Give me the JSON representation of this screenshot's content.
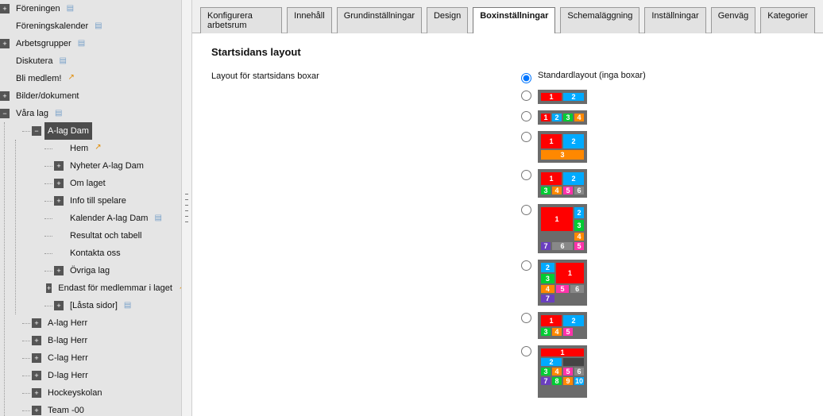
{
  "sidebar": {
    "items": [
      {
        "label": "Föreningen",
        "toggle": "plus",
        "doc": true
      },
      {
        "label": "Föreningskalender",
        "toggle": "spacer",
        "doc": true
      },
      {
        "label": "Arbetsgrupper",
        "toggle": "plus",
        "doc": true
      },
      {
        "label": "Diskutera",
        "toggle": "spacer",
        "doc": true
      },
      {
        "label": "Bli medlem!",
        "toggle": "spacer",
        "link": true
      },
      {
        "label": "Bilder/dokument",
        "toggle": "plus"
      },
      {
        "label": "Våra lag",
        "toggle": "minus",
        "doc": true,
        "children": [
          {
            "label": "A-lag Dam",
            "toggle": "minus",
            "selected": true,
            "children": [
              {
                "label": "Hem",
                "toggle": "spacer",
                "link": true
              },
              {
                "label": "Nyheter A-lag Dam",
                "toggle": "plus"
              },
              {
                "label": "Om laget",
                "toggle": "plus"
              },
              {
                "label": "Info till spelare",
                "toggle": "plus"
              },
              {
                "label": "Kalender A-lag Dam",
                "toggle": "spacer",
                "doc": true
              },
              {
                "label": "Resultat och tabell",
                "toggle": "spacer"
              },
              {
                "label": "Kontakta oss",
                "toggle": "spacer"
              },
              {
                "label": "Övriga lag",
                "toggle": "plus"
              },
              {
                "label": "Endast för medlemmar i laget",
                "toggle": "plus",
                "link": true
              },
              {
                "label": "[Låsta sidor]",
                "toggle": "plus",
                "doc": true
              }
            ]
          },
          {
            "label": "A-lag Herr",
            "toggle": "plus"
          },
          {
            "label": "B-lag Herr",
            "toggle": "plus"
          },
          {
            "label": "C-lag Herr",
            "toggle": "plus"
          },
          {
            "label": "D-lag Herr",
            "toggle": "plus"
          },
          {
            "label": "Hockeyskolan",
            "toggle": "plus"
          },
          {
            "label": "Team -00",
            "toggle": "plus"
          }
        ]
      }
    ]
  },
  "tabs": [
    {
      "label": "Konfigurera arbetsrum"
    },
    {
      "label": "Innehåll"
    },
    {
      "label": "Grundinställningar"
    },
    {
      "label": "Design"
    },
    {
      "label": "Boxinställningar",
      "active": true
    },
    {
      "label": "Schemaläggning"
    },
    {
      "label": "Inställningar"
    },
    {
      "label": "Genväg"
    },
    {
      "label": "Kategorier"
    }
  ],
  "panel": {
    "section_title": "Startsidans layout",
    "form_label": "Layout för startsidans boxar",
    "default_label": "Standardlayout (inga boxar)"
  },
  "layout_options": [
    {
      "id": "default",
      "selected": true,
      "text_only": true
    },
    {
      "id": "l2",
      "grid": "t-2",
      "cells": [
        [
          "1",
          "c-red"
        ],
        [
          "2",
          "c-blue"
        ]
      ]
    },
    {
      "id": "l4",
      "grid": "t-4",
      "cells": [
        [
          "1",
          "c-red"
        ],
        [
          "2",
          "c-blue"
        ],
        [
          "3",
          "c-green"
        ],
        [
          "4",
          "c-orange"
        ]
      ]
    },
    {
      "id": "l2row",
      "grid": "t-2x2a",
      "cells": [
        [
          "1",
          "c-red"
        ],
        [
          "2",
          "c-blue"
        ],
        [
          "3",
          "c-orange"
        ]
      ]
    },
    {
      "id": "l2x3",
      "grid": "t-2x2b",
      "cells": [
        [
          "1",
          "c-red"
        ],
        [
          "2",
          "c-blue"
        ],
        [
          "3",
          "c-green"
        ],
        [
          "4",
          "c-orange"
        ],
        [
          "5",
          "c-pink"
        ],
        [
          "6",
          "c-grey"
        ]
      ]
    },
    {
      "id": "l7",
      "grid": "t-147",
      "cells": [
        [
          "1",
          "c-red"
        ],
        [
          "2",
          "c-blue"
        ],
        [
          "3",
          "c-green"
        ],
        [
          "4",
          "c-orange"
        ],
        [
          "7",
          "c-purple"
        ],
        [
          "6",
          "c-grey"
        ],
        [
          "5",
          "c-pink"
        ]
      ]
    },
    {
      "id": "l6",
      "grid": "t-231",
      "cells": [
        [
          "2",
          "c-blue"
        ],
        [
          "3",
          "c-green"
        ],
        [
          "1",
          "c-red"
        ],
        [
          "4",
          "c-orange"
        ],
        [
          "5",
          "c-pink"
        ],
        [
          "6",
          "c-grey"
        ],
        [
          "7",
          "c-purple"
        ]
      ]
    },
    {
      "id": "l5",
      "grid": "t-125",
      "cells": [
        [
          "1",
          "c-red"
        ],
        [
          "2",
          "c-blue"
        ],
        [
          "3",
          "c-green"
        ],
        [
          "4",
          "c-orange"
        ],
        [
          "5",
          "c-pink"
        ]
      ]
    },
    {
      "id": "l10",
      "grid": "t-big",
      "cells": [
        [
          "1",
          "c-red"
        ],
        [
          "2",
          "c-blue"
        ],
        [
          "",
          "c-dark"
        ],
        [
          "3",
          "c-green"
        ],
        [
          "4",
          "c-orange"
        ],
        [
          "5",
          "c-pink"
        ],
        [
          "6",
          "c-grey"
        ],
        [
          "7",
          "c-purple"
        ],
        [
          "8",
          "c-green"
        ],
        [
          "9",
          "c-orange"
        ],
        [
          "10",
          "c-blue"
        ]
      ]
    }
  ]
}
